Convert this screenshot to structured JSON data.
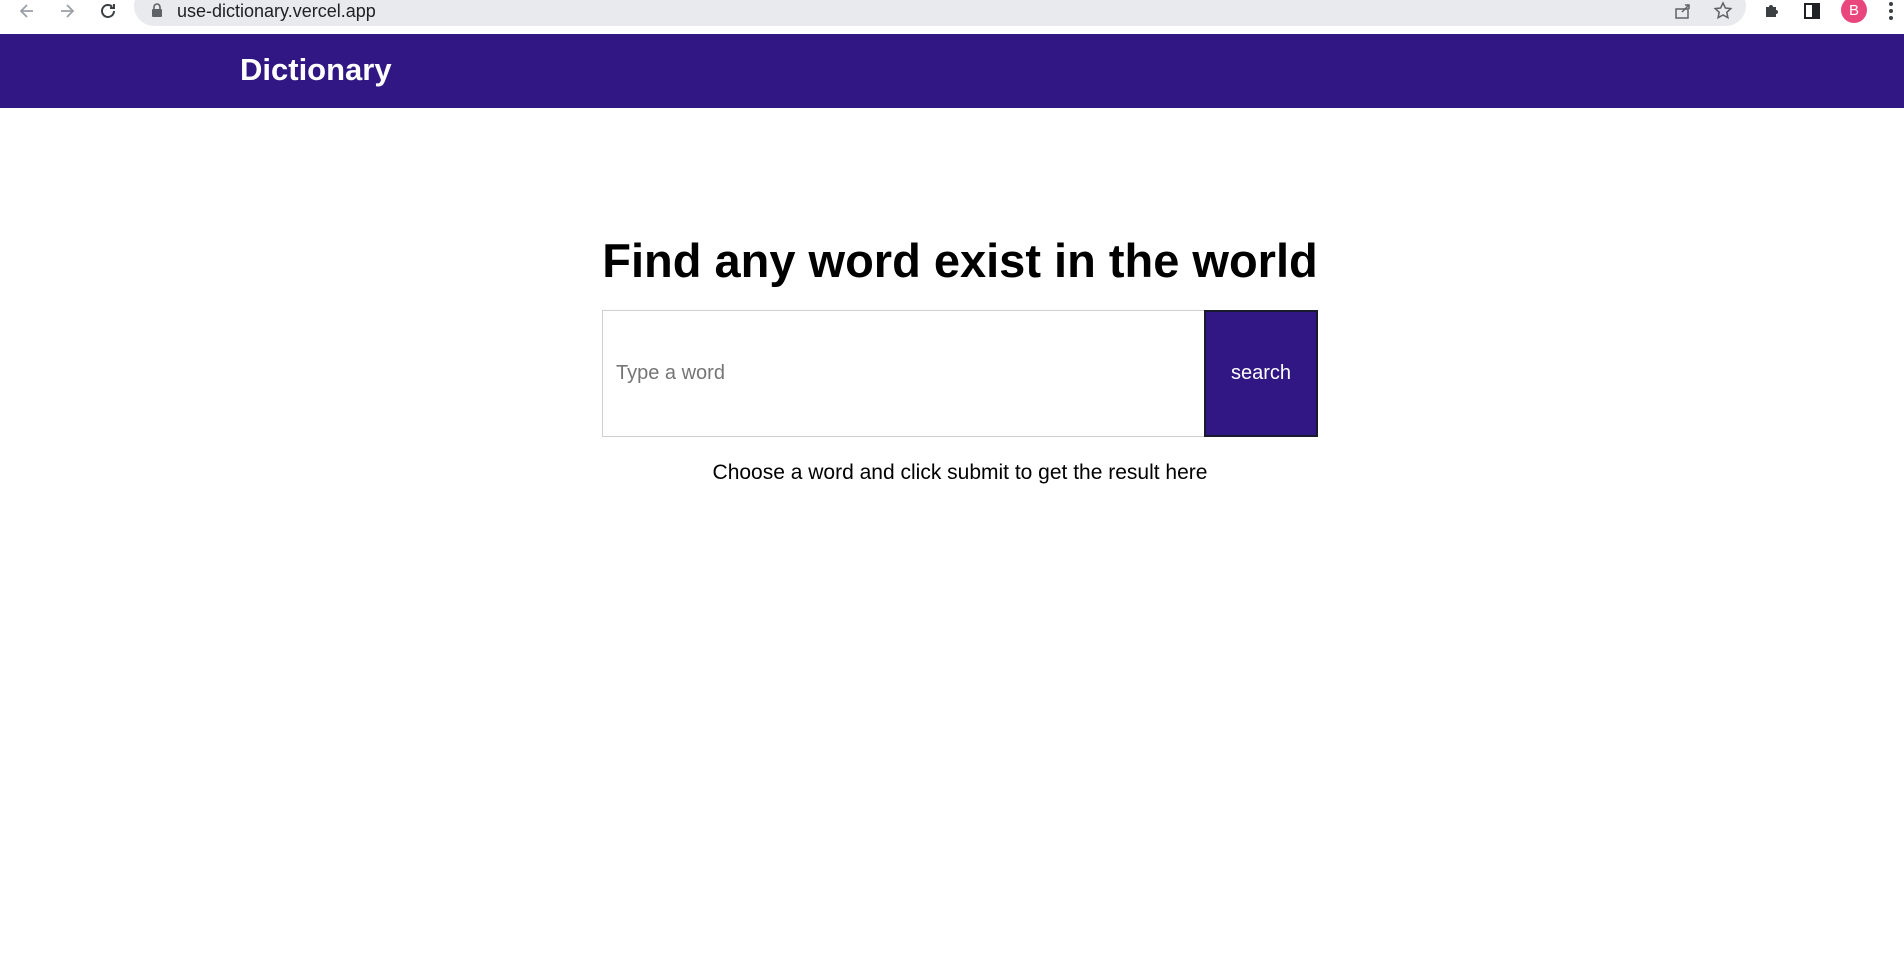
{
  "browser": {
    "url": "use-dictionary.vercel.app",
    "profile_initial": "B",
    "icons": {
      "back": "arrow-left-icon",
      "forward": "arrow-right-icon",
      "reload": "reload-icon",
      "lock": "lock-icon",
      "share": "share-icon",
      "bookmark": "star-icon",
      "extensions": "puzzle-icon",
      "side_panel": "side-panel-icon",
      "menu": "more-vertical-icon"
    }
  },
  "header": {
    "title": "Dictionary",
    "background": "#311784"
  },
  "main": {
    "headline": "Find any word exist in the world",
    "search": {
      "placeholder": "Type a word",
      "value": "",
      "button_label": "search"
    },
    "hint": "Choose a word and click submit to get the result here"
  },
  "colors": {
    "accent": "#311784",
    "profile": "#e8467c"
  }
}
